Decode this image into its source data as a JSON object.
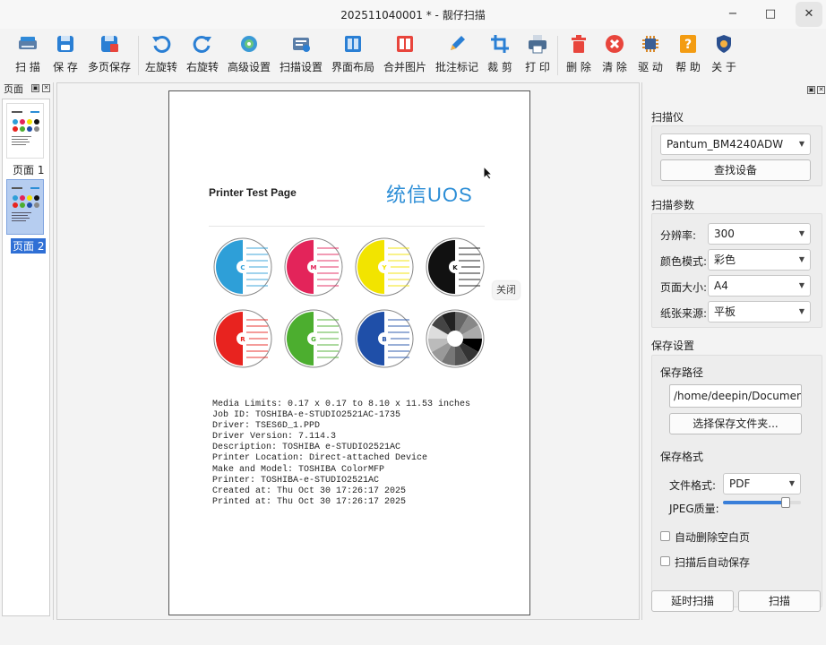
{
  "window": {
    "title": "202511040001 * - 靓仔扫描",
    "minimize": "−",
    "maximize": "□",
    "close": "✕"
  },
  "toolbar": {
    "items": [
      {
        "label": "扫 描",
        "icon": "scanner-icon"
      },
      {
        "label": "保 存",
        "icon": "save-icon"
      },
      {
        "label": "多页保存",
        "icon": "multi-save-icon"
      },
      {
        "label": "左旋转",
        "icon": "rotate-left-icon"
      },
      {
        "label": "右旋转",
        "icon": "rotate-right-icon"
      },
      {
        "label": "高级设置",
        "icon": "advanced-settings-icon"
      },
      {
        "label": "扫描设置",
        "icon": "scan-settings-icon"
      },
      {
        "label": "界面布局",
        "icon": "layout-icon"
      },
      {
        "label": "合并图片",
        "icon": "merge-images-icon"
      },
      {
        "label": "批注标记",
        "icon": "annotate-pen-icon"
      },
      {
        "label": "裁 剪",
        "icon": "crop-icon"
      },
      {
        "label": "打 印",
        "icon": "printer-icon"
      },
      {
        "label": "删 除",
        "icon": "trash-icon"
      },
      {
        "label": "清 除",
        "icon": "clear-icon"
      },
      {
        "label": "驱 动",
        "icon": "driver-chip-icon"
      },
      {
        "label": "帮 助",
        "icon": "help-icon"
      },
      {
        "label": "关 于",
        "icon": "about-shield-icon"
      }
    ]
  },
  "pages_panel": {
    "title": "页面",
    "pages": [
      {
        "label": "页面 1",
        "selected": false
      },
      {
        "label": "页面 2",
        "selected": true
      }
    ]
  },
  "preview": {
    "heading": "Printer Test Page",
    "logo": "统信UOS",
    "close_tip": "关闭",
    "circles": [
      {
        "letter": "C",
        "color": "#2e9fd8"
      },
      {
        "letter": "M",
        "color": "#e3245a"
      },
      {
        "letter": "Y",
        "color": "#f2e400"
      },
      {
        "letter": "K",
        "color": "#111111"
      },
      {
        "letter": "R",
        "color": "#e8231f"
      },
      {
        "letter": "G",
        "color": "#4cae2f"
      },
      {
        "letter": "B",
        "color": "#1f4fa8"
      },
      {
        "letter": "",
        "color": "#777777"
      }
    ],
    "info_lines": [
      "Media Limits: 0.17 x 0.17 to 8.10 x 11.53 inches",
      "Job ID: TOSHIBA-e-STUDIO2521AC-1735",
      "Driver: TSES6D_1.PPD",
      "Driver Version: 7.114.3",
      "Description: TOSHIBA e-STUDIO2521AC",
      "Printer Location: Direct-attached Device",
      "Make and Model: TOSHIBA ColorMFP",
      "Printer: TOSHIBA-e-STUDIO2521AC",
      "Created at: Thu Oct 30 17:26:17 2025",
      "Printed at: Thu Oct 30 17:26:17 2025"
    ]
  },
  "settings": {
    "scanner_title": "扫描仪",
    "scanner_value": "Pantum_BM4240ADW",
    "find_device": "查找设备",
    "params_title": "扫描参数",
    "params": [
      {
        "label": "分辨率:",
        "value": "300"
      },
      {
        "label": "颜色模式:",
        "value": "彩色"
      },
      {
        "label": "页面大小:",
        "value": "A4"
      },
      {
        "label": "纸张来源:",
        "value": "平板"
      }
    ],
    "save_title": "保存设置",
    "save_path_title": "保存路径",
    "save_path_value": "/home/deepin/Documents",
    "choose_folder": "选择保存文件夹...",
    "format_title": "保存格式",
    "file_format_label": "文件格式:",
    "file_format_value": "PDF",
    "jpeg_quality_label": "JPEG质量:",
    "jpeg_quality": 0.8,
    "auto_delete_blank": "自动删除空白页",
    "auto_save_after_scan": "扫描后自动保存",
    "delay_scan": "延时扫描",
    "scan": "扫描"
  }
}
